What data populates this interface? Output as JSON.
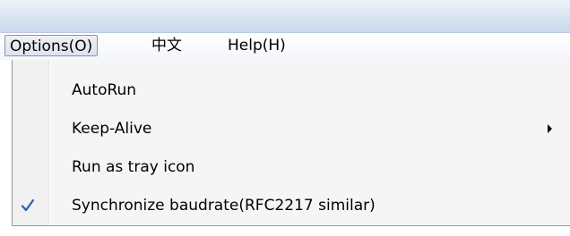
{
  "menubar": {
    "items": [
      {
        "label": "Options(O)",
        "active": true
      },
      {
        "label": "中文",
        "active": false
      },
      {
        "label": "Help(H)",
        "active": false
      }
    ]
  },
  "dropdown": {
    "items": [
      {
        "label": "AutoRun",
        "checked": false,
        "has_submenu": false
      },
      {
        "label": "Keep-Alive",
        "checked": false,
        "has_submenu": true
      },
      {
        "label": "Run as tray icon",
        "checked": false,
        "has_submenu": false
      },
      {
        "label": "Synchronize baudrate(RFC2217 similar)",
        "checked": true,
        "has_submenu": false
      }
    ],
    "check_icon": "checkmark-icon",
    "submenu_icon": "chevron-right-icon",
    "check_color": "#2a5fb5"
  }
}
